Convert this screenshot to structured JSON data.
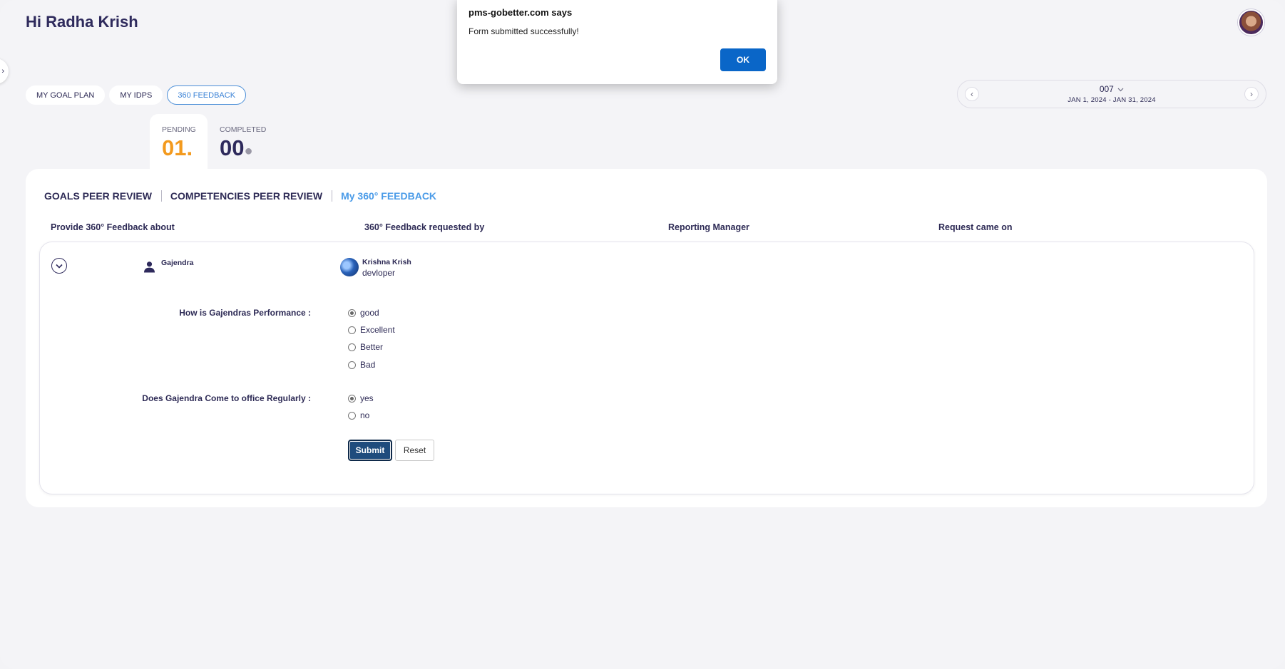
{
  "header": {
    "greeting": "Hi Radha Krish"
  },
  "main_tabs": [
    {
      "label": "MY GOAL PLAN",
      "active": false
    },
    {
      "label": "MY IDPS",
      "active": false
    },
    {
      "label": "360 FEEDBACK",
      "active": true
    }
  ],
  "period": {
    "name": "007",
    "dates": "JAN 1, 2024 - JAN 31, 2024"
  },
  "status": {
    "pending_label": "PENDING",
    "pending_count": "01",
    "completed_label": "COMPLETED",
    "completed_count": "00"
  },
  "sub_tabs": [
    {
      "label": "GOALS PEER REVIEW",
      "active": false
    },
    {
      "label": "COMPETENCIES PEER REVIEW",
      "active": false
    },
    {
      "label": "My 360° FEEDBACK",
      "active": true
    }
  ],
  "table": {
    "headers": [
      "Provide 360° Feedback about",
      "360° Feedback requested by",
      "Reporting Manager",
      "Request came on"
    ]
  },
  "row": {
    "subject": "Gajendra",
    "requester_name": "Krishna Krish",
    "requester_role": "devloper"
  },
  "questions": [
    {
      "label": "How is Gajendras Performance :",
      "options": [
        {
          "label": "good",
          "checked": true
        },
        {
          "label": "Excellent",
          "checked": false
        },
        {
          "label": "Better",
          "checked": false
        },
        {
          "label": "Bad",
          "checked": false
        }
      ]
    },
    {
      "label": "Does Gajendra Come to office Regularly :",
      "options": [
        {
          "label": "yes",
          "checked": true
        },
        {
          "label": "no",
          "checked": false
        }
      ]
    }
  ],
  "form": {
    "submit_label": "Submit",
    "reset_label": "Reset"
  },
  "dialog": {
    "title": "pms-gobetter.com says",
    "message": "Form submitted successfully!",
    "ok_label": "OK"
  },
  "colors": {
    "accent_blue": "#4a9be8",
    "pending_orange": "#f39a1e",
    "navy_text": "#2e2a5c",
    "dialog_button": "#0a66c8"
  }
}
